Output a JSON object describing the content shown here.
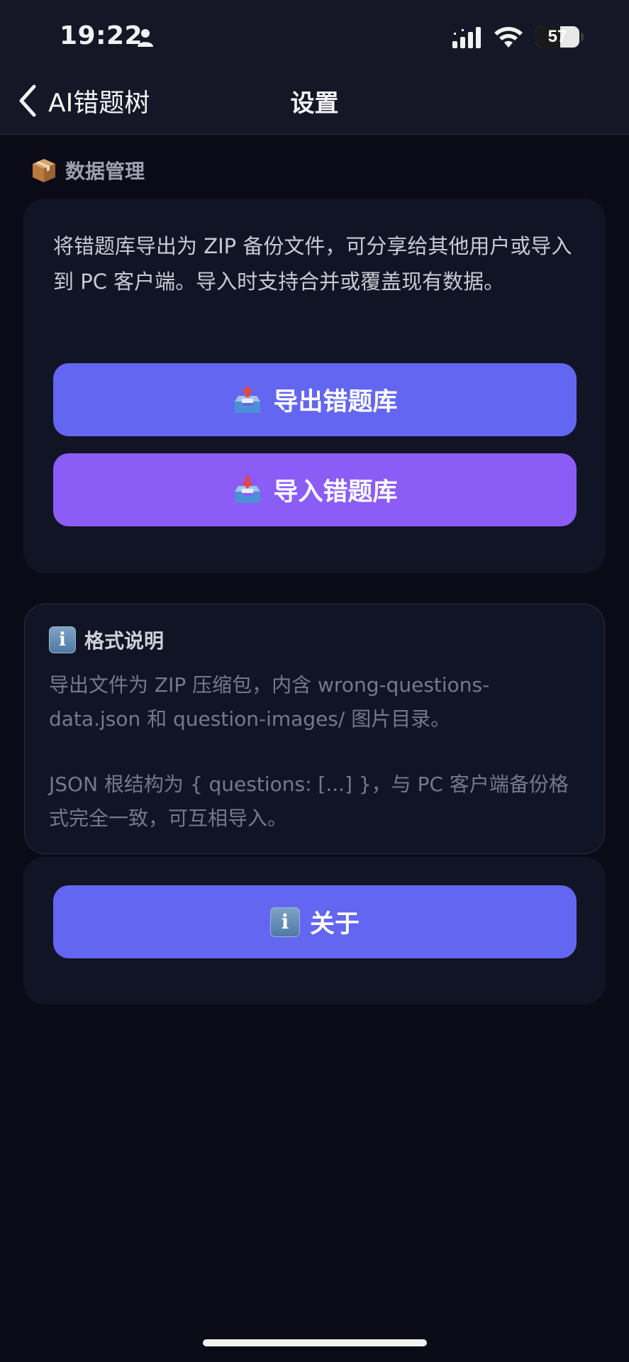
{
  "status_bar": {
    "time": "19:22",
    "battery_level": "57",
    "battery_fraction": 0.57,
    "icons": [
      "person-icon",
      "cellular-signal-icon",
      "wifi-icon",
      "battery-icon"
    ]
  },
  "nav": {
    "back_label": "AI错题树",
    "title": "设置"
  },
  "data_section": {
    "emoji": "package-icon",
    "title": "数据管理",
    "description": "将错题库导出为 ZIP 备份文件，可分享给其他用户或导入到 PC 客户端。导入时支持合并或覆盖现有数据。",
    "export_label": "导出错题库",
    "import_label": "导入错题库"
  },
  "format_info": {
    "icon": "info-icon",
    "badge_letter": "i",
    "title": "格式说明",
    "paragraph1": "导出文件为 ZIP 压缩包，内含 wrong-questions-data.json 和 question-images/ 图片目录。",
    "paragraph2": "JSON 根结构为 { questions: [...] }，与 PC 客户端备份格式完全一致，可互相导入。"
  },
  "about": {
    "label": "关于"
  },
  "colors": {
    "background": "#0b0b18",
    "card": "#111424",
    "primary": "#6366f1",
    "secondary": "#8b5cf6"
  }
}
